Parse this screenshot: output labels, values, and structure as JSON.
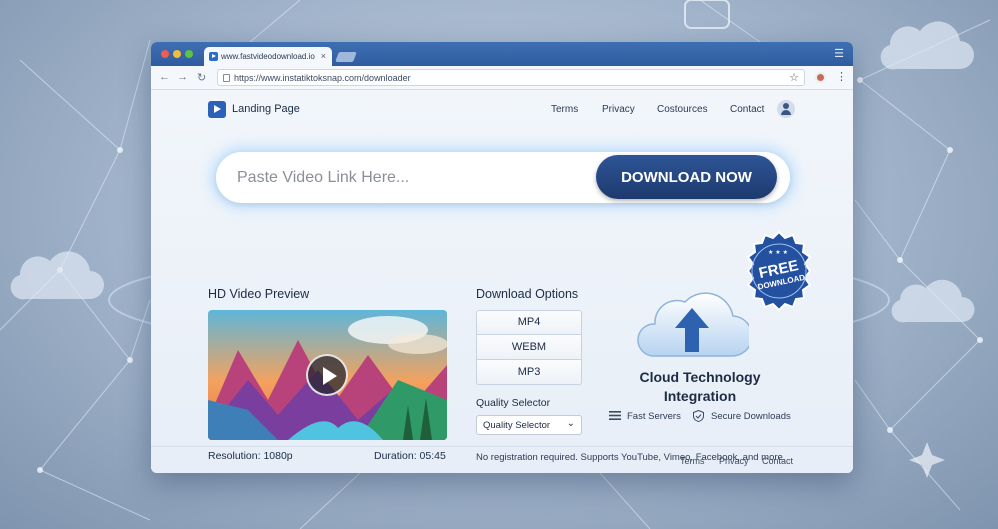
{
  "browser": {
    "tab_title": "www.fastvideodownload.io",
    "tab_close": "×",
    "url": "https://www.instatiktoksnap.com/downloader",
    "back": "←",
    "forward": "→",
    "reload": "↻",
    "star": "☆",
    "menu": "⋮",
    "window_menu": "☰"
  },
  "header": {
    "logo_text": "Landing Page",
    "nav": [
      "Terms",
      "Privacy",
      "Costources",
      "Contact"
    ]
  },
  "search": {
    "placeholder": "Paste Video Link Here...",
    "button_label": "DOWNLOAD NOW"
  },
  "badge": {
    "line1": "FREE",
    "line2": "DOWNLOAD"
  },
  "preview": {
    "title": "HD Video Preview",
    "resolution_label": "Resolution:",
    "resolution_value": "1080p",
    "duration_label": "Duration:",
    "duration_value": "05:45"
  },
  "download_options": {
    "title": "Download Options",
    "formats": [
      "MP4",
      "WEBM",
      "MP3"
    ],
    "quality_title": "Quality Selector",
    "quality_selected": "Quality Selector"
  },
  "cloud": {
    "title_line1": "Cloud Technology",
    "title_line2": "Integration",
    "features": [
      "Fast Servers",
      "Secure Downloads"
    ]
  },
  "notice": "No registration required. Supports YouTube, Vimeo, Facebook, and more.",
  "footer": {
    "links": [
      "Terms",
      "Privacy",
      "Contact"
    ]
  },
  "colors": {
    "accent": "#1d3a6f",
    "brand_blue": "#2b62b8",
    "titlebar": "#3f6fb3"
  }
}
